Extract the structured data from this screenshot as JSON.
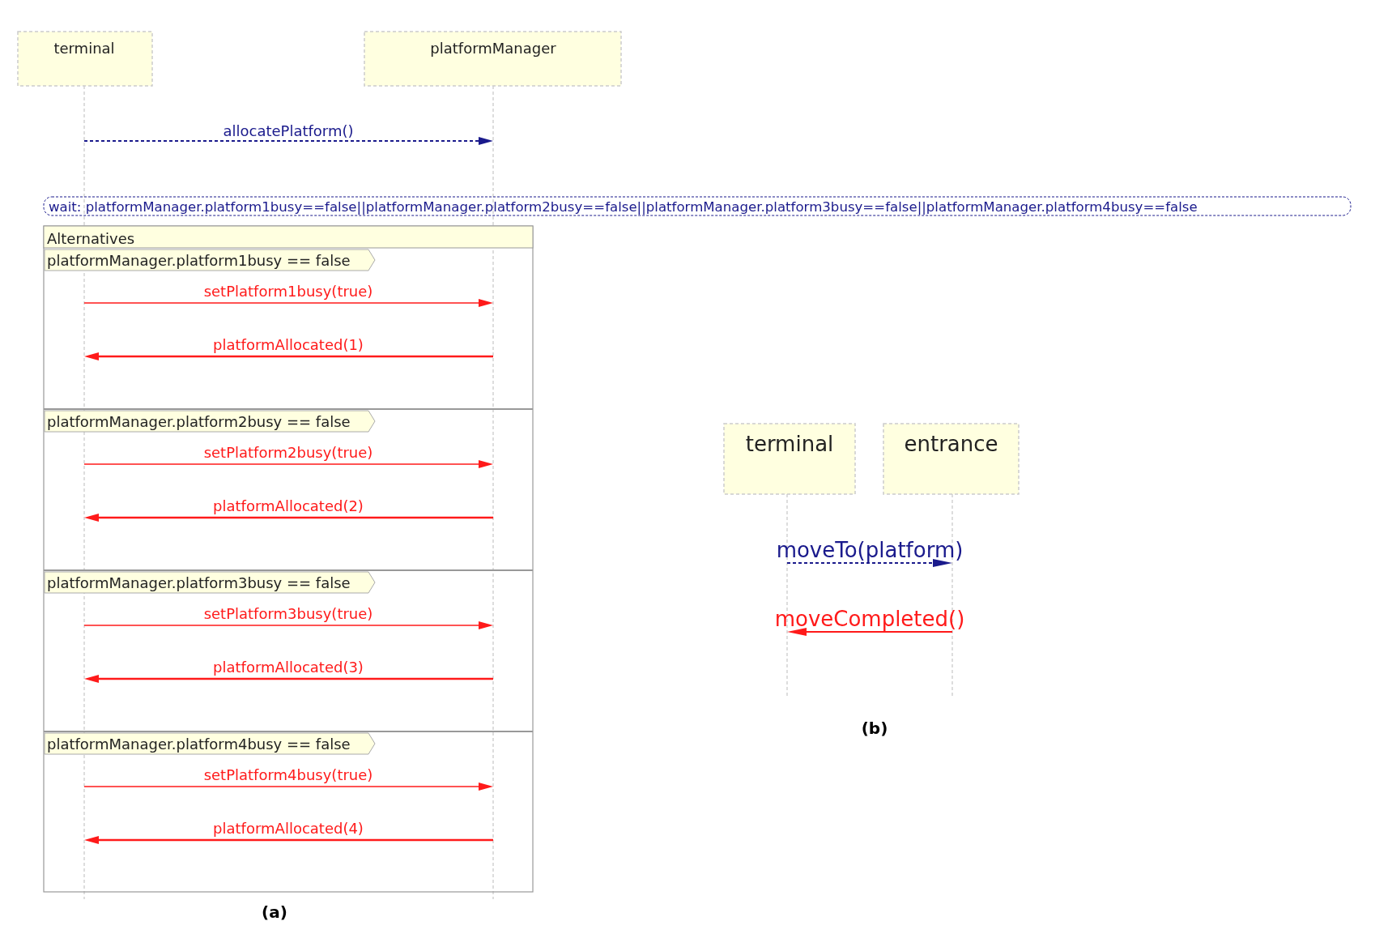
{
  "diagram_a": {
    "lifelines": [
      {
        "name": "terminal"
      },
      {
        "name": "platformManager"
      }
    ],
    "messages": [
      {
        "label": "allocatePlatform()",
        "kind": "async",
        "points_left": false
      }
    ],
    "wait_condition": "wait: platformManager.platform1busy==false||platformManager.platform2busy==false||platformManager.platform3busy==false||platformManager.platform4busy==false",
    "fragment": {
      "label": "Alternatives",
      "operands": [
        {
          "guard": "platformManager.platform1busy == false",
          "messages": [
            {
              "label": "setPlatform1busy(true)",
              "kind": "sync",
              "points_left": false
            },
            {
              "label": "platformAllocated(1)",
              "kind": "sync",
              "points_left": true
            }
          ]
        },
        {
          "guard": "platformManager.platform2busy == false",
          "messages": [
            {
              "label": "setPlatform2busy(true)",
              "kind": "sync",
              "points_left": false
            },
            {
              "label": "platformAllocated(2)",
              "kind": "sync",
              "points_left": true
            }
          ]
        },
        {
          "guard": "platformManager.platform3busy == false",
          "messages": [
            {
              "label": "setPlatform3busy(true)",
              "kind": "sync",
              "points_left": false
            },
            {
              "label": "platformAllocated(3)",
              "kind": "sync",
              "points_left": true
            }
          ]
        },
        {
          "guard": "platformManager.platform4busy == false",
          "messages": [
            {
              "label": "setPlatform4busy(true)",
              "kind": "sync",
              "points_left": false
            },
            {
              "label": "platformAllocated(4)",
              "kind": "sync",
              "points_left": true
            }
          ]
        }
      ]
    },
    "caption": "(a)"
  },
  "diagram_b": {
    "lifelines": [
      {
        "name": "terminal"
      },
      {
        "name": "entrance"
      }
    ],
    "messages": [
      {
        "label": "moveTo(platform)",
        "kind": "async",
        "points_left": false
      },
      {
        "label": "moveCompleted()",
        "kind": "sync",
        "points_left": true
      }
    ],
    "caption": "(b)"
  }
}
